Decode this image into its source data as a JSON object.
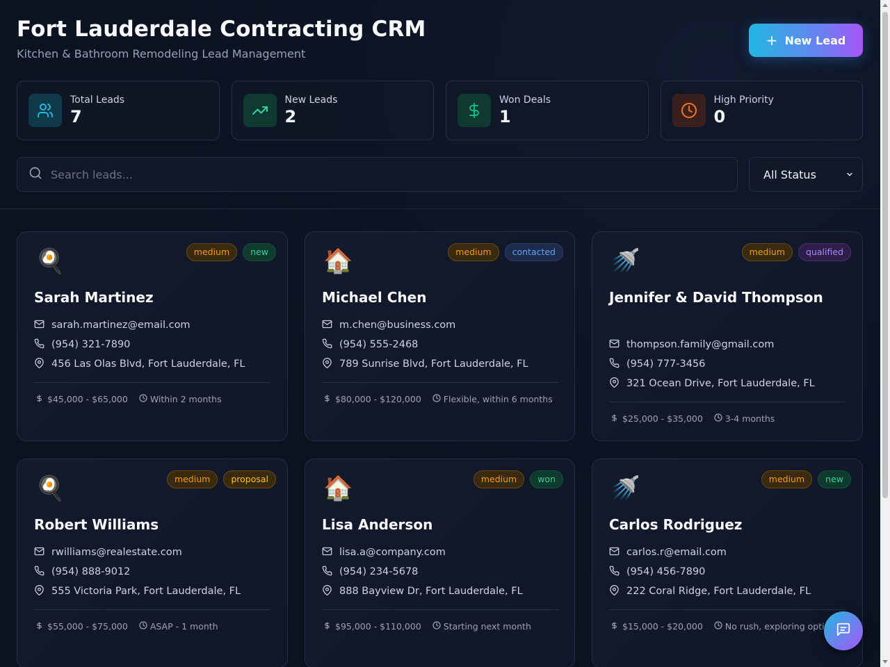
{
  "header": {
    "title": "Fort Lauderdale Contracting CRM",
    "subtitle": "Kitchen & Bathroom Remodeling Lead Management",
    "new_lead_label": "New Lead"
  },
  "stats": [
    {
      "label": "Total Leads",
      "value": "7",
      "icon": "users-icon",
      "color": "#22b8e0"
    },
    {
      "label": "New Leads",
      "value": "2",
      "icon": "trending-up-icon",
      "color": "#34d399"
    },
    {
      "label": "Won Deals",
      "value": "1",
      "icon": "dollar-icon",
      "color": "#10b981"
    },
    {
      "label": "High Priority",
      "value": "0",
      "icon": "clock-icon",
      "color": "#f97316"
    }
  ],
  "search": {
    "placeholder": "Search leads...",
    "value": ""
  },
  "status_filter": {
    "selected": "All Status"
  },
  "leads": [
    {
      "emoji": "🍳",
      "type": "kitchen",
      "priority": "medium",
      "status": "new",
      "name": "Sarah Martinez",
      "email": "sarah.martinez@email.com",
      "phone": "(954) 321-7890",
      "address": "456 Las Olas Blvd, Fort Lauderdale, FL",
      "budget": "$45,000 - $65,000",
      "timeline": "Within 2 months"
    },
    {
      "emoji": "🏠",
      "type": "home",
      "priority": "medium",
      "status": "contacted",
      "name": "Michael Chen",
      "email": "m.chen@business.com",
      "phone": "(954) 555-2468",
      "address": "789 Sunrise Blvd, Fort Lauderdale, FL",
      "budget": "$80,000 - $120,000",
      "timeline": "Flexible, within 6 months"
    },
    {
      "emoji": "🚿",
      "type": "bathroom",
      "priority": "medium",
      "status": "qualified",
      "name": "Jennifer & David Thompson",
      "email": "thompson.family@gmail.com",
      "phone": "(954) 777-3456",
      "address": "321 Ocean Drive, Fort Lauderdale, FL",
      "budget": "$25,000 - $35,000",
      "timeline": "3-4 months"
    },
    {
      "emoji": "🍳",
      "type": "kitchen",
      "priority": "medium",
      "status": "proposal",
      "name": "Robert Williams",
      "email": "rwilliams@realestate.com",
      "phone": "(954) 888-9012",
      "address": "555 Victoria Park, Fort Lauderdale, FL",
      "budget": "$55,000 - $75,000",
      "timeline": "ASAP - 1 month"
    },
    {
      "emoji": "🏠",
      "type": "home",
      "priority": "medium",
      "status": "won",
      "name": "Lisa Anderson",
      "email": "lisa.a@company.com",
      "phone": "(954) 234-5678",
      "address": "888 Bayview Dr, Fort Lauderdale, FL",
      "budget": "$95,000 - $110,000",
      "timeline": "Starting next month"
    },
    {
      "emoji": "🚿",
      "type": "bathroom",
      "priority": "medium",
      "status": "new",
      "name": "Carlos Rodriguez",
      "email": "carlos.r@email.com",
      "phone": "(954) 456-7890",
      "address": "222 Coral Ridge, Fort Lauderdale, FL",
      "budget": "$15,000 - $20,000",
      "timeline": "No rush, exploring options"
    }
  ]
}
